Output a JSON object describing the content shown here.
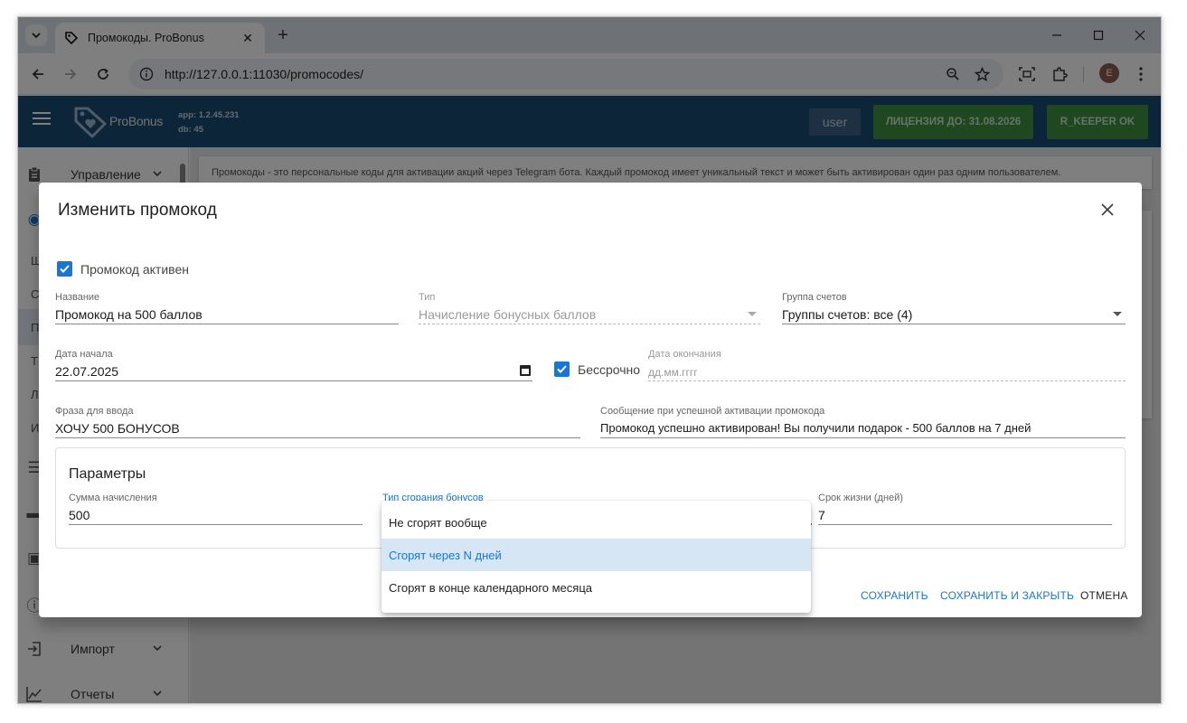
{
  "browser": {
    "tab_title": "Промокоды. ProBonus",
    "url": "http://127.0.0.1:11030/promocodes/",
    "profile_initial": "E"
  },
  "app": {
    "logo_text": "ProBonus",
    "version_app": "app: 1.2.45.231",
    "version_db": "db: 45",
    "user": "user",
    "license": "ЛИЦЕНЗИЯ ДО: 31.08.2026",
    "rkeeper": "R_KEEPER OK"
  },
  "sidebar": {
    "items": [
      {
        "label": "Управление"
      },
      {
        "letter": "Ш"
      },
      {
        "letter": "С"
      },
      {
        "letter": "П"
      },
      {
        "letter": "Т"
      },
      {
        "letter": "Л"
      },
      {
        "letter": "И"
      },
      {
        "label": "Импорт"
      },
      {
        "label": "Отчеты"
      }
    ]
  },
  "content": {
    "info_text": "Промокоды - это персональные коды для активации акций через Telegram бота. Каждый промокод имеет уникальный текст и может быть активирован один раз одним пользователем."
  },
  "dialog": {
    "title": "Изменить промокод",
    "active_label": "Промокод активен",
    "name": {
      "label": "Название",
      "value": "Промокод на 500 баллов"
    },
    "type": {
      "label": "Тип",
      "value": "Начисление бонусных баллов"
    },
    "group": {
      "label": "Группа счетов",
      "value": "Группы счетов: все (4)"
    },
    "start_date": {
      "label": "Дата начала",
      "value": "22.07.2025"
    },
    "unlimited_label": "Бессрочно",
    "end_date": {
      "label": "Дата окончания",
      "placeholder": "дд.мм.гггг"
    },
    "phrase": {
      "label": "Фраза для ввода",
      "value": "ХОЧУ 500 БОНУСОВ"
    },
    "message": {
      "label": "Сообщение при успешной активации промокода",
      "value": "Промокод успешно активирован! Вы получили подарок -  500 баллов на 7 дней"
    },
    "params": {
      "title": "Параметры",
      "amount": {
        "label": "Сумма начисления",
        "value": "500"
      },
      "burn_type": {
        "label": "Тип сгорания бонусов"
      },
      "lifetime": {
        "label": "Срок жизни (дней)",
        "value": "7"
      }
    },
    "buttons": {
      "save": "СОХРАНИТЬ",
      "save_close": "СОХРАНИТЬ И ЗАКРЫТЬ",
      "cancel": "ОТМЕНА"
    }
  },
  "menu": {
    "options": [
      {
        "label": "Не сгорят вообще",
        "selected": false
      },
      {
        "label": "Сгорят через N дней",
        "selected": true
      },
      {
        "label": "Сгорят в конце календарного месяца",
        "selected": false
      }
    ]
  },
  "colors": {
    "appbar": "#1b4b73",
    "license_green": "#3e8e41",
    "accent": "#1976d2"
  }
}
